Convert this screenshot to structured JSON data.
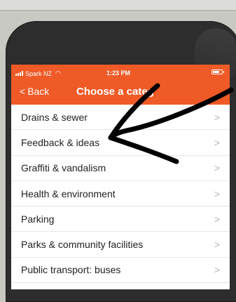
{
  "status_bar": {
    "carrier": "Spark NZ",
    "time": "1:23 PM"
  },
  "nav": {
    "back_label": "Back",
    "back_chevron": "<",
    "title": "Choose a categ"
  },
  "items": [
    {
      "label": "Drains & sewer"
    },
    {
      "label": "Feedback & ideas"
    },
    {
      "label": "Graffiti & vandalism"
    },
    {
      "label": "Health & environment"
    },
    {
      "label": "Parking"
    },
    {
      "label": "Parks & community facilities"
    },
    {
      "label": "Public transport: buses"
    }
  ],
  "icons": {
    "chevron": "chevron-right-icon",
    "signal": "signal-icon",
    "wifi": "wifi-icon",
    "battery": "battery-icon"
  },
  "colors": {
    "accent": "#ef5a27",
    "annotation": "#000000"
  }
}
